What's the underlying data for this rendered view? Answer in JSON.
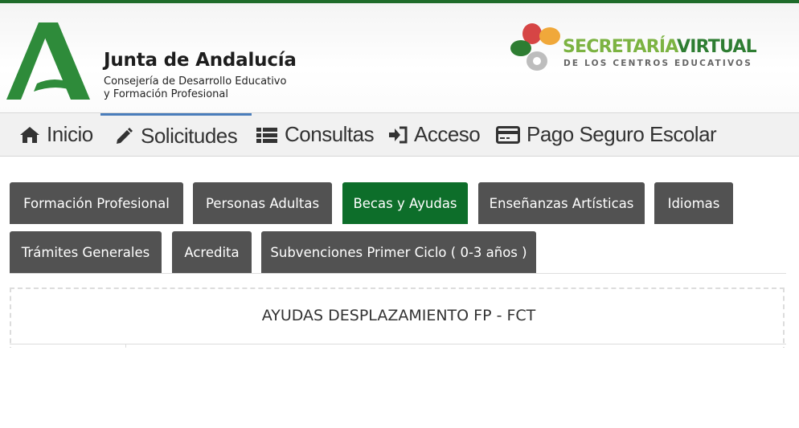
{
  "header": {
    "org_name": "Junta de Andalucía",
    "org_sub_1": "Consejería de Desarrollo Educativo",
    "org_sub_2": "y Formación Profesional",
    "sv_title_1": "SECRETARÍA",
    "sv_title_2": "VIRTUAL",
    "sv_subtitle": "DE LOS CENTROS EDUCATIVOS",
    "colors": {
      "brand_green": "#2e7d32",
      "light_green": "#7cb342",
      "top_bar": "#1e6b2a"
    }
  },
  "nav": {
    "items": [
      {
        "label": "Inicio",
        "icon": "home-icon"
      },
      {
        "label": "Solicitudes",
        "icon": "pencil-icon",
        "active": true
      },
      {
        "label": "Consultas",
        "icon": "list-icon"
      },
      {
        "label": "Acceso",
        "icon": "sign-in-icon"
      },
      {
        "label": "Pago Seguro Escolar",
        "icon": "credit-card-icon"
      }
    ]
  },
  "tabs": {
    "items": [
      {
        "label": "Formación Profesional"
      },
      {
        "label": "Personas Adultas"
      },
      {
        "label": "Becas y Ayudas",
        "active": true
      },
      {
        "label": "Enseñanzas Artísticas"
      },
      {
        "label": "Idiomas"
      },
      {
        "label": "Trámites Generales"
      },
      {
        "label": "Acredita"
      },
      {
        "label": "Subvenciones Primer Ciclo ( 0-3 años )"
      }
    ],
    "colors": {
      "tab_bg": "#525252",
      "active_bg": "#0d6e2a"
    }
  },
  "panel": {
    "title": "AYUDAS DESPLAZAMIENTO FP - FCT"
  }
}
